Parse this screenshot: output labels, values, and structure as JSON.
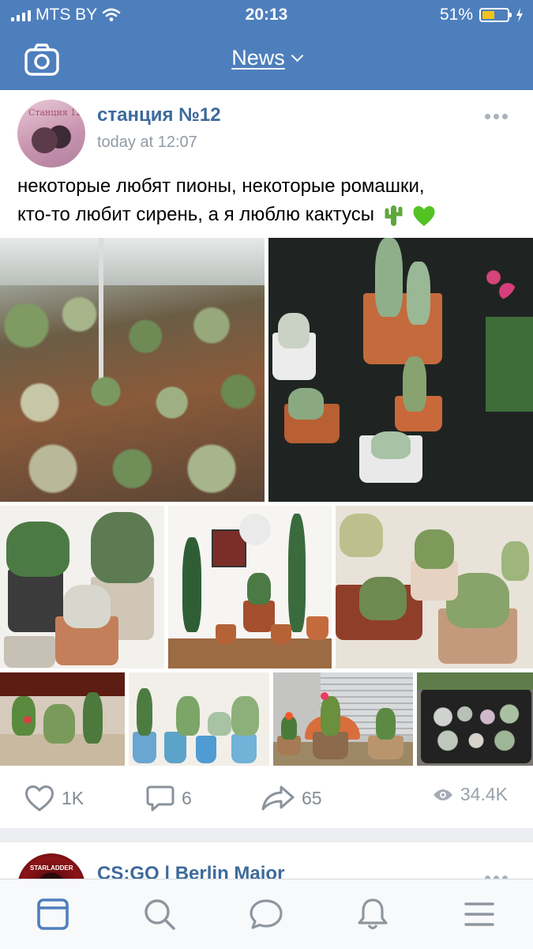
{
  "status_bar": {
    "carrier": "MTS BY",
    "time": "20:13",
    "battery_percent": "51%",
    "battery_level": 0.51
  },
  "nav": {
    "title": "News",
    "camera_icon": "camera-icon",
    "dropdown_icon": "chevron-down-icon"
  },
  "post": {
    "author": "станция №12",
    "time": "today at 12:07",
    "text_line1": "некоторые любят пионы, некоторые ромашки,",
    "text_line2": "кто-то любит сирень, а я люблю кактусы",
    "emoji": [
      "cactus-emoji",
      "green-heart-emoji"
    ],
    "photo_count": 9,
    "likes": "1K",
    "comments": "6",
    "shares": "65",
    "views": "34.4K"
  },
  "next_post": {
    "author": "CS:GO | Berlin Major"
  },
  "tabbar": {
    "items": [
      "news-icon",
      "search-icon",
      "messages-icon",
      "notifications-icon",
      "menu-icon"
    ],
    "active": "news-icon",
    "accent": "#4e7fbd"
  },
  "colors": {
    "header": "#4e7fbd",
    "author_link": "#3d6a9c",
    "meta_text": "#929aa3"
  }
}
